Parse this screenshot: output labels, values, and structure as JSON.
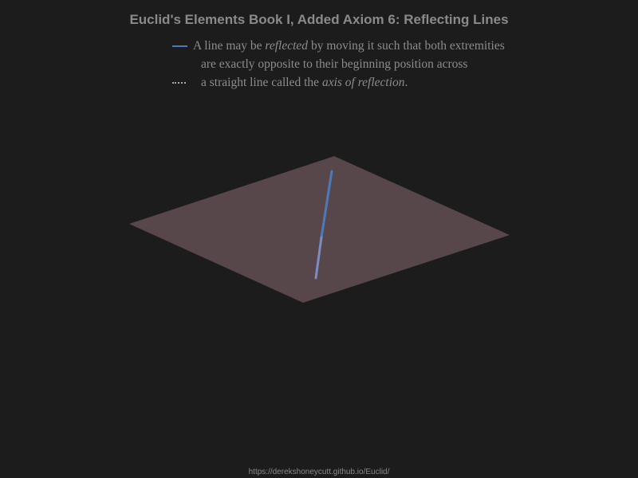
{
  "title": "Euclid's Elements Book I, Added Axiom 6: Reflecting Lines",
  "legend": {
    "line1_pre": "A line may be ",
    "line1_em": "reflected",
    "line1_post": " by moving it such that both extremities",
    "line2": "are exactly opposite to their beginning position across",
    "line3_pre": "a straight line called the ",
    "line3_em": "axis of reflection",
    "line3_post": "."
  },
  "colors": {
    "background": "#1c1c1c",
    "plane": "#58474a",
    "line": "#4a7ab8",
    "line_reflected": "#7a8cc0",
    "text": "#8c8c8c"
  },
  "footer": "https://derekshoneycutt.github.io/Euclid/"
}
